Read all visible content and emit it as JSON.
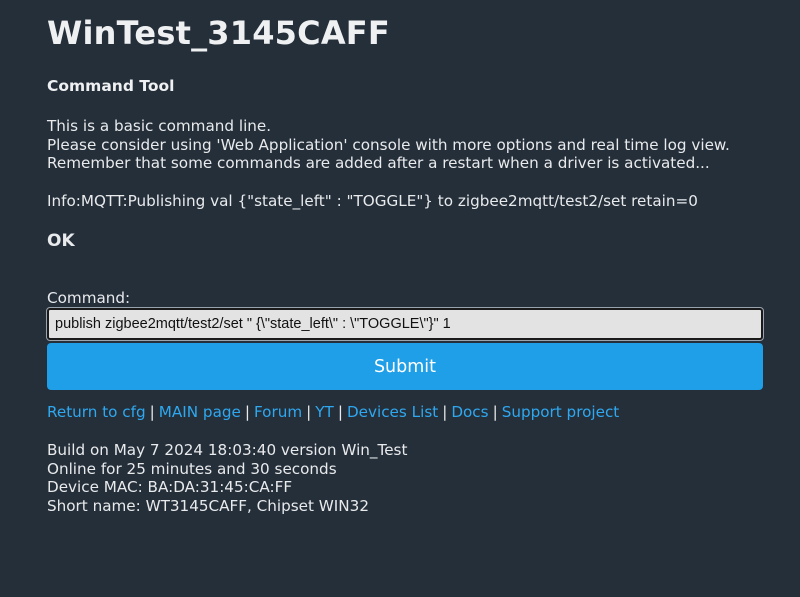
{
  "page": {
    "title": "WinTest_3145CAFF",
    "subtitle": "Command Tool"
  },
  "intro": {
    "line1": "This is a basic command line.",
    "line2": "Please consider using 'Web Application' console with more options and real time log view.",
    "line3": "Remember that some commands are added after a restart when a driver is activated..."
  },
  "log": {
    "message": "Info:MQTT:Publishing val {\"state_left\" : \"TOGGLE\"} to zigbee2mqtt/test2/set retain=0"
  },
  "result": {
    "status": "OK"
  },
  "command": {
    "label": "Command:",
    "value": "publish zigbee2mqtt/test2/set \" {\\\"state_left\\\" : \\\"TOGGLE\\\"}\" 1",
    "submit_label": "Submit"
  },
  "links": [
    {
      "label": "Return to cfg"
    },
    {
      "label": "MAIN page"
    },
    {
      "label": "Forum"
    },
    {
      "label": "YT"
    },
    {
      "label": "Devices List"
    },
    {
      "label": "Docs"
    },
    {
      "label": "Support project"
    }
  ],
  "links_separator": "|",
  "info": {
    "build": "Build on May 7 2024 18:03:40 version Win_Test",
    "uptime": "Online for 25 minutes and 30 seconds",
    "mac": "Device MAC: BA:DA:31:45:CA:FF",
    "short_name": "Short name: WT3145CAFF, Chipset WIN32"
  },
  "colors": {
    "background": "#252f3a",
    "accent": "#1e9fe8",
    "link": "#2ea8f0"
  }
}
